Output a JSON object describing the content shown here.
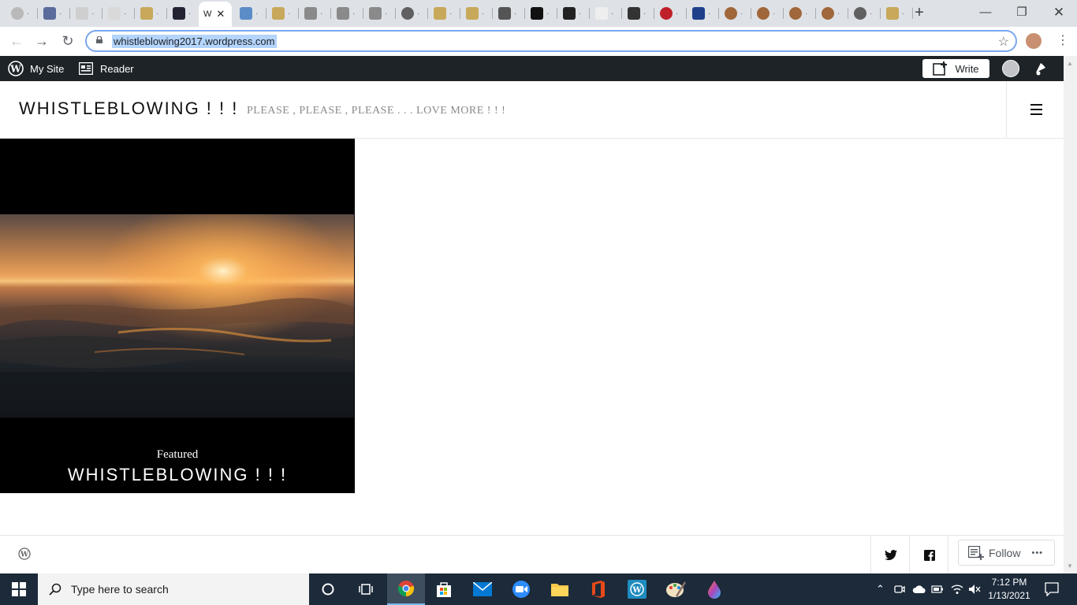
{
  "browser": {
    "tabs": [
      {
        "icon": "seal-icon",
        "color": "#b9b9b9"
      },
      {
        "icon": "image-favicon",
        "color": "#5a6b9c"
      },
      {
        "icon": "text-favicon",
        "color": "#cfcfcf"
      },
      {
        "icon": "document-favicon",
        "color": "#d9d9d9"
      },
      {
        "icon": "figure-favicon",
        "color": "#c8a85a"
      },
      {
        "icon": "dark-image-favicon",
        "color": "#222233"
      },
      {
        "icon": "active-tab",
        "color": "#ffffff",
        "title": "W"
      },
      {
        "icon": "blue-logo-favicon",
        "color": "#5b8cc8"
      },
      {
        "icon": "figure-favicon",
        "color": "#c8a85a"
      },
      {
        "icon": "eye-favicon",
        "color": "#8a8a8a"
      },
      {
        "icon": "eye-favicon",
        "color": "#8a8a8a"
      },
      {
        "icon": "eye-favicon",
        "color": "#8a8a8a"
      },
      {
        "icon": "globe-favicon",
        "color": "#606060"
      },
      {
        "icon": "figure-favicon",
        "color": "#c8a85a"
      },
      {
        "icon": "figure-favicon",
        "color": "#c8a85a"
      },
      {
        "icon": "photo-favicon",
        "color": "#555555"
      },
      {
        "icon": "black-box-favicon",
        "color": "#111111"
      },
      {
        "icon": "dark-favicon",
        "color": "#222222"
      },
      {
        "icon": "white-box-favicon",
        "color": "#eeeeee"
      },
      {
        "icon": "hand-favicon",
        "color": "#333333"
      },
      {
        "icon": "red-circle-favicon",
        "color": "#c0202a"
      },
      {
        "icon": "blue-box-favicon",
        "color": "#1f3f8a"
      },
      {
        "icon": "ball-favicon",
        "color": "#a0673a"
      },
      {
        "icon": "ball-favicon",
        "color": "#a0673a"
      },
      {
        "icon": "ball-favicon",
        "color": "#a0673a"
      },
      {
        "icon": "ball-favicon",
        "color": "#a0673a"
      },
      {
        "icon": "globe-favicon",
        "color": "#606060"
      },
      {
        "icon": "figure-favicon",
        "color": "#c8a85a"
      }
    ],
    "url": "whistleblowing2017.wordpress.com"
  },
  "wpbar": {
    "my_site": "My Site",
    "reader": "Reader",
    "write": "Write"
  },
  "site": {
    "title": "WHISTLEBLOWING ! ! !",
    "tagline": "PLEASE , PLEASE , PLEASE . . . LOVE MORE ! ! !"
  },
  "featured": {
    "label": "Featured",
    "title": "WHISTLEBLOWING ! ! !"
  },
  "footer": {
    "follow": "Follow",
    "more": "•••"
  },
  "taskbar": {
    "search_placeholder": "Type here to search",
    "time": "7:12 PM",
    "date": "1/13/2021"
  },
  "colors": {
    "wpbar_bg": "#1d2327",
    "taskbar_bg": "#1c2a3a",
    "featured_bg": "#000000"
  }
}
